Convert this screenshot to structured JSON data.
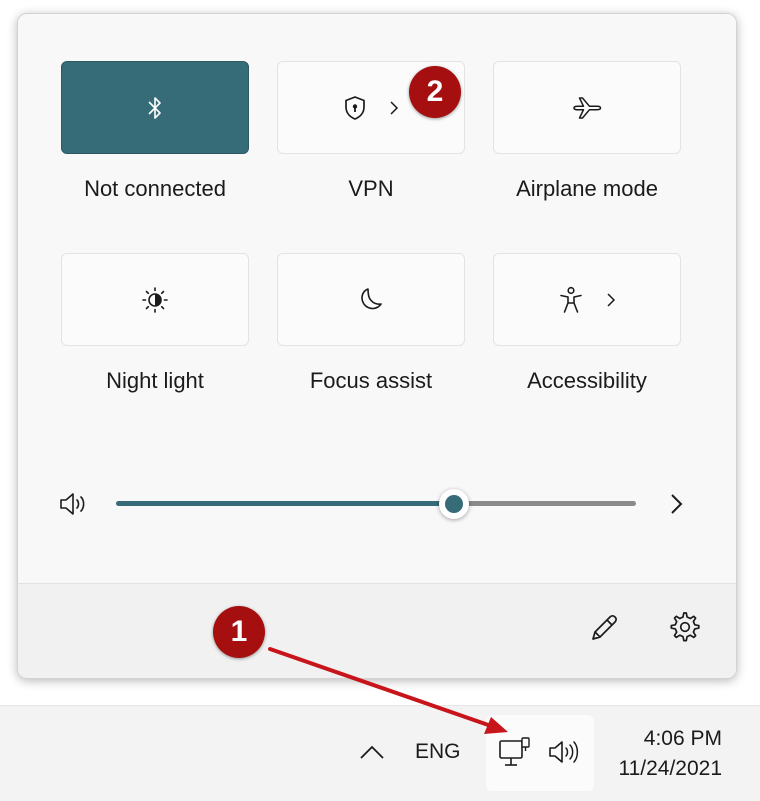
{
  "quick_settings": {
    "tiles": [
      {
        "label": "Not connected",
        "icon": "bluetooth-icon",
        "active": true
      },
      {
        "label": "VPN",
        "icon": "shield-icon",
        "has_submenu": true
      },
      {
        "label": "Airplane mode",
        "icon": "airplane-icon"
      },
      {
        "label": "Night light",
        "icon": "brightness-icon"
      },
      {
        "label": "Focus assist",
        "icon": "moon-icon"
      },
      {
        "label": "Accessibility",
        "icon": "accessibility-icon",
        "has_submenu": true
      }
    ],
    "volume": {
      "level_fraction": 0.65,
      "icon": "speaker-icon"
    },
    "footer": {
      "edit_icon": "pencil-icon",
      "settings_icon": "gear-icon"
    }
  },
  "taskbar": {
    "language": "ENG",
    "time": "4:06 PM",
    "date": "11/24/2021",
    "icons": [
      "chevron-up-icon",
      "network-icon",
      "speaker-icon"
    ]
  },
  "annotations": {
    "badge_1": "1",
    "badge_2": "2",
    "colors": {
      "badge": "#a50f0f",
      "accent": "#366c78",
      "arrow": "#c8151b"
    }
  }
}
